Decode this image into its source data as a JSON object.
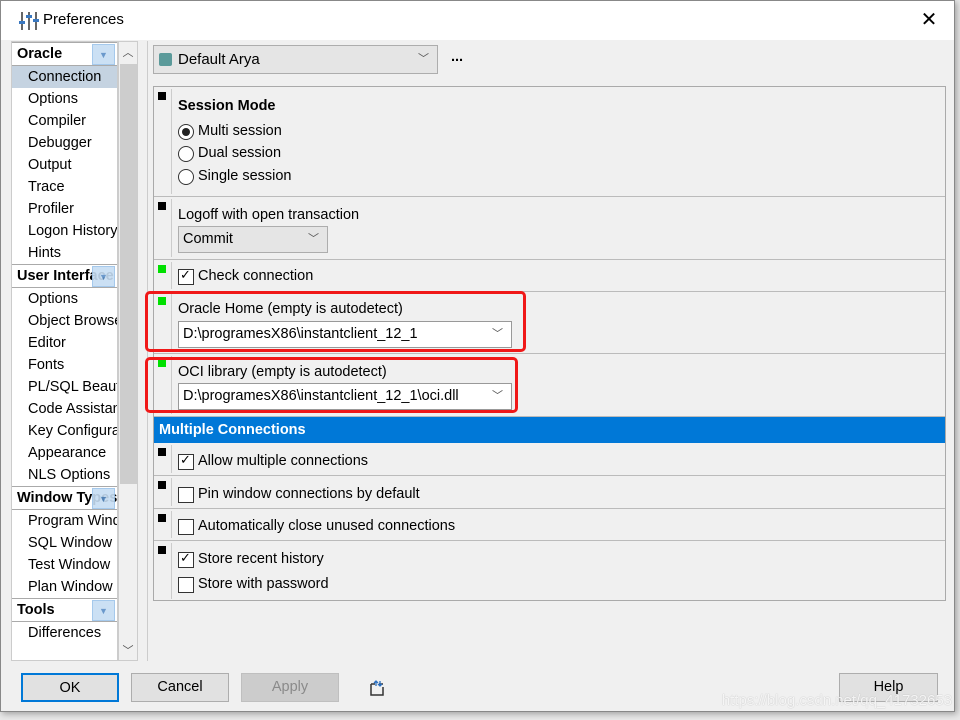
{
  "window": {
    "title": "Preferences",
    "close": "✕"
  },
  "tree": {
    "groups": [
      {
        "label": "Oracle",
        "items": [
          "Connection",
          "Options",
          "Compiler",
          "Debugger",
          "Output",
          "Trace",
          "Profiler",
          "Logon History",
          "Hints"
        ]
      },
      {
        "label": "User Interface",
        "items": [
          "Options",
          "Object Browser",
          "Editor",
          "Fonts",
          "PL/SQL Beautifier",
          "Code Assistant",
          "Key Configuration",
          "Appearance",
          "NLS Options"
        ]
      },
      {
        "label": "Window Types",
        "items": [
          "Program Window",
          "SQL Window",
          "Test Window",
          "Plan Window"
        ]
      },
      {
        "label": "Tools",
        "items": [
          "Differences"
        ]
      }
    ],
    "selected": "Connection"
  },
  "profile": {
    "value": "Default Arya",
    "more": "..."
  },
  "session": {
    "title": "Session Mode",
    "options": [
      "Multi session",
      "Dual session",
      "Single session"
    ],
    "selected": "Multi session"
  },
  "logoff": {
    "label": "Logoff with open transaction",
    "value": "Commit"
  },
  "check_connection": {
    "label": "Check connection",
    "checked": true
  },
  "oracle_home": {
    "label": "Oracle Home (empty is autodetect)",
    "value": "D:\\programesX86\\instantclient_12_1"
  },
  "oci": {
    "label": "OCI library (empty is autodetect)",
    "value": "D:\\programesX86\\instantclient_12_1\\oci.dll"
  },
  "multi": {
    "header": "Multiple Connections",
    "allow": {
      "label": "Allow multiple connections",
      "checked": true
    },
    "pin": {
      "label": "Pin window connections by default",
      "checked": false
    },
    "autoclose": {
      "label": "Automatically close unused connections",
      "checked": false
    },
    "history": {
      "label": "Store recent history",
      "checked": true
    },
    "password": {
      "label": "Store with password",
      "checked": false
    }
  },
  "buttons": {
    "ok": "OK",
    "cancel": "Cancel",
    "apply": "Apply",
    "help": "Help"
  },
  "colors": {
    "accent": "#0078d7",
    "highlight": "#f01818",
    "indicator_green": "#00e000"
  },
  "watermark": "https://blog.csdn.net/qq_41732653"
}
